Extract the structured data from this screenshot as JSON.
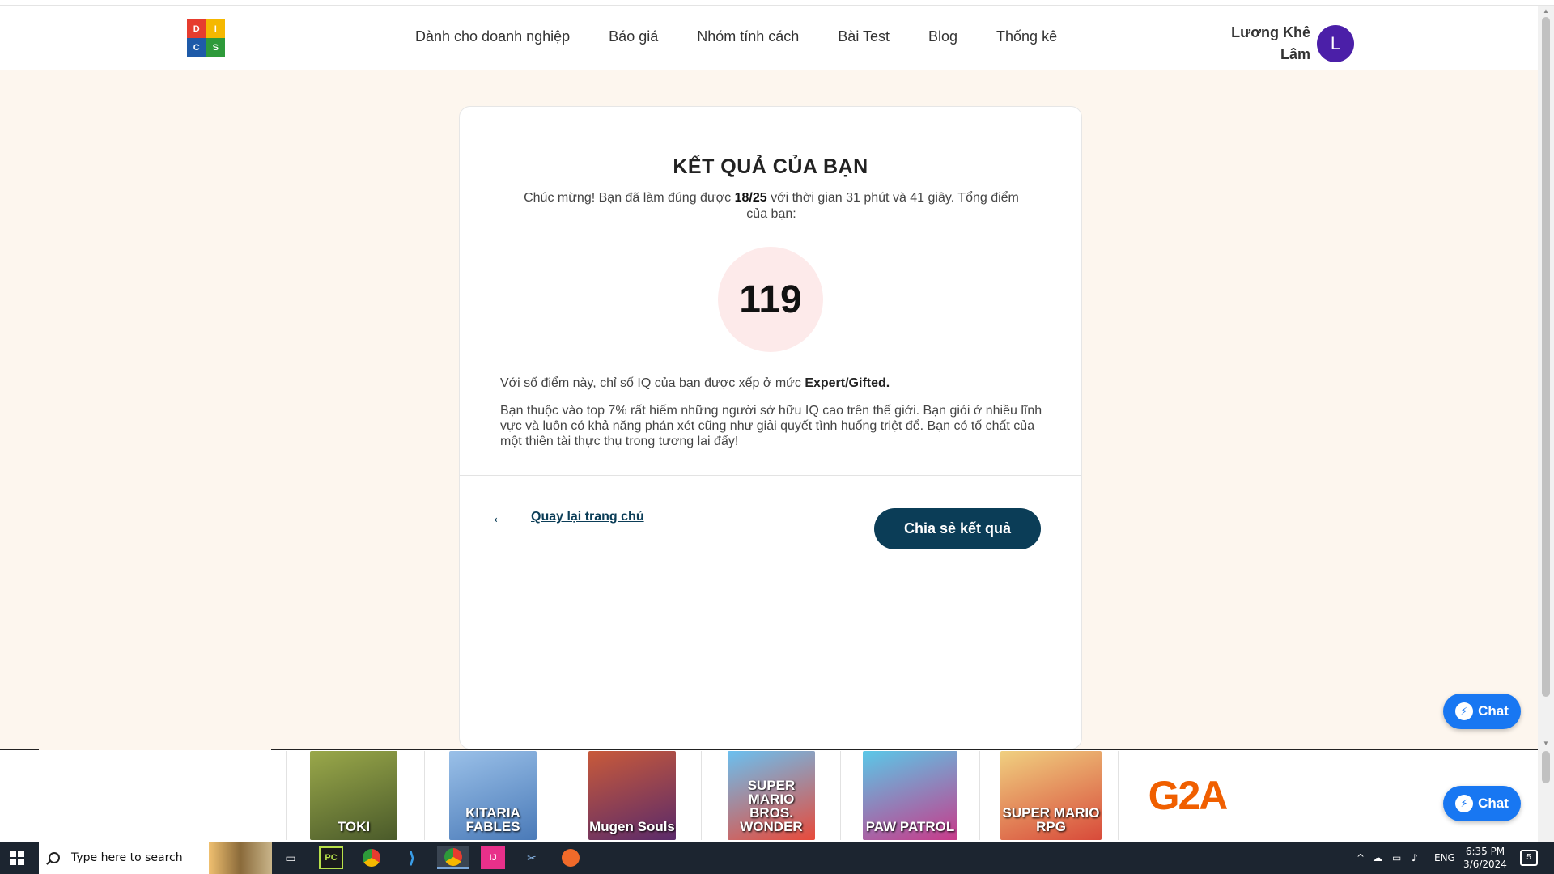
{
  "header": {
    "logo_letters": [
      "D",
      "I",
      "C",
      "S"
    ],
    "logo_colors": [
      "#e63c2f",
      "#f5b800",
      "#1e5aa8",
      "#2e9a3a"
    ],
    "nav": [
      {
        "label": "Dành cho doanh nghiệp"
      },
      {
        "label": "Báo giá"
      },
      {
        "label": "Nhóm tính cách"
      },
      {
        "label": "Bài Test"
      },
      {
        "label": "Blog"
      },
      {
        "label": "Thống kê"
      }
    ],
    "user_name": "Lương Khê Lâm",
    "avatar_initial": "L"
  },
  "result": {
    "title": "KẾT QUẢ CỦA BẠN",
    "sub_before": "Chúc mừng! Bạn đã làm đúng được ",
    "correct": "18/25",
    "sub_after": " với thời gian 31 phút và 41 giây. Tổng điểm của bạn:",
    "score": "119",
    "iq_text": "Với số điểm này, chỉ số IQ của bạn được xếp ở mức ",
    "iq_level": "Expert/Gifted.",
    "description": "Bạn thuộc vào top 7% rất hiếm những người sở hữu IQ cao trên thế giới. Bạn giỏi ở nhiều lĩnh vực và luôn có khả năng phán xét cũng như giải quyết tình huống triệt để. Bạn có tố chất của một thiên tài thực thụ trong tương lai đấy!",
    "back_arrow": "←",
    "back_label": "Quay lại trang chủ",
    "share_label": "Chia sẻ kết quả"
  },
  "chat": {
    "label": "Chat",
    "color": "#1877f2"
  },
  "ads": {
    "games": [
      {
        "name": "TOKI",
        "color": "#6b7a3a"
      },
      {
        "name": "KITARIA FABLES",
        "color": "#5a8cc8"
      },
      {
        "name": "Mugen Souls",
        "color": "#7a3a5a"
      },
      {
        "name": "SUPER MARIO BROS. WONDER",
        "color": "#3a8ad0"
      },
      {
        "name": "PAW PATROL",
        "color": "#3aa0d8"
      },
      {
        "name": "SUPER MARIO RPG",
        "color": "#d8a040"
      }
    ],
    "brand": "G2A"
  },
  "taskbar": {
    "search_placeholder": "Type here to search",
    "language": "ENG",
    "time": "6:35 PM",
    "date": "3/6/2024",
    "notifications": "5"
  }
}
